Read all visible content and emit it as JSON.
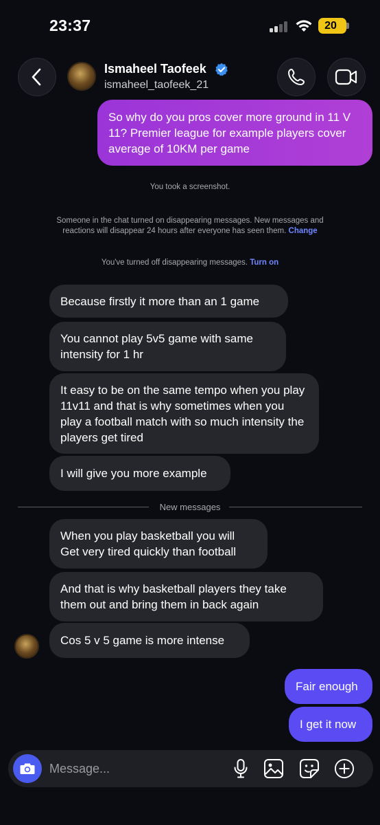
{
  "status_bar": {
    "time": "23:37",
    "battery": "20"
  },
  "header": {
    "name": "Ismaheel Taofeek",
    "handle": "ismaheel_taofeek_21",
    "verified": true
  },
  "messages": {
    "m1": "So why do you pros cover more ground in 11 V 11? Premier league for example players cover average of 10KM per game",
    "m2": "Because firstly it more than an 1 game",
    "m3": "You cannot play 5v5 game with same intensity for 1 hr",
    "m4": "It easy to be on the same tempo when you play 11v11 and that is why sometimes when you play a football match with so much intensity the players get tired",
    "m5": "I will give you more example",
    "m6": "When you play basketball you will Get very tired quickly than football",
    "m7": "And that is why basketball players they take them out and bring them in back again",
    "m8": "Cos 5 v 5 game is more intense",
    "m9": "Fair enough",
    "m10": "I get it now"
  },
  "system": {
    "screenshot": "You took a screenshot.",
    "disappearing_on": "Someone in the chat turned on disappearing messages. New messages and reactions will disappear 24 hours after everyone has seen them.",
    "change_link": "Change",
    "disappearing_off": "You've turned off disappearing messages.",
    "turn_on_link": "Turn on",
    "new_messages": "New messages"
  },
  "composer": {
    "placeholder": "Message..."
  },
  "colors": {
    "background": "#0b0c12",
    "incoming_bubble": "#26272c",
    "outgoing_purple": "#a83ad8",
    "outgoing_blue": "#5b4bf2",
    "link": "#6f86ff",
    "camera_button": "#4a5cf0"
  },
  "icons": [
    "back-chevron-icon",
    "verified-badge-icon",
    "phone-icon",
    "video-camera-icon",
    "camera-icon",
    "microphone-icon",
    "gallery-icon",
    "sticker-icon",
    "plus-circle-icon"
  ]
}
